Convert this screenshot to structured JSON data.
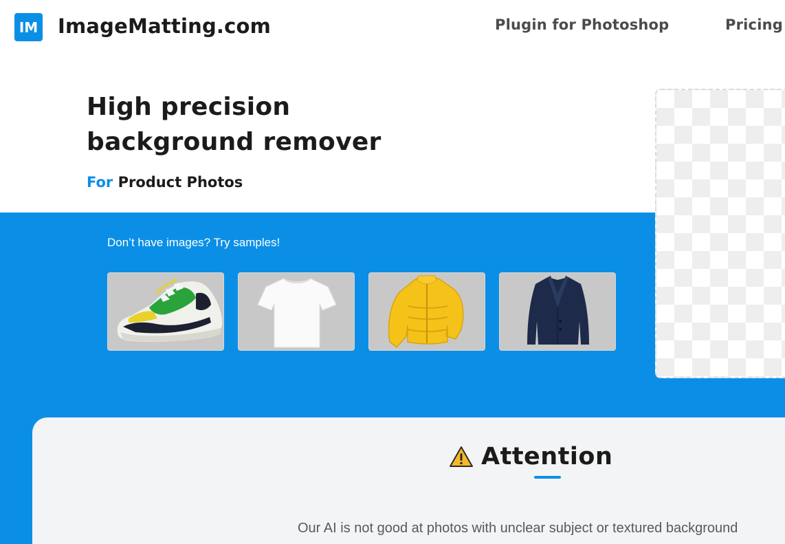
{
  "header": {
    "logo_badge": "IM",
    "logo_text": "ImageMatting.com",
    "nav": [
      {
        "label": "Plugin for Photoshop"
      },
      {
        "label": "Pricing"
      }
    ]
  },
  "hero": {
    "title_line1": "High precision",
    "title_line2": "background remover",
    "subtitle_for": "For",
    "subtitle_rest": "Product Photos"
  },
  "samples": {
    "label": "Don’t have images? Try samples!",
    "items": [
      {
        "subject": "sneaker"
      },
      {
        "subject": "white t-shirt"
      },
      {
        "subject": "yellow puffer jacket"
      },
      {
        "subject": "navy blazer"
      }
    ]
  },
  "attention": {
    "icon": "warning-icon",
    "title": "Attention",
    "body": "Our AI is not good at photos with unclear subject or textured background"
  },
  "colors": {
    "accent": "#0b8fe6",
    "card_bg": "#f3f4f6",
    "text_dark": "#1b1b1b"
  }
}
